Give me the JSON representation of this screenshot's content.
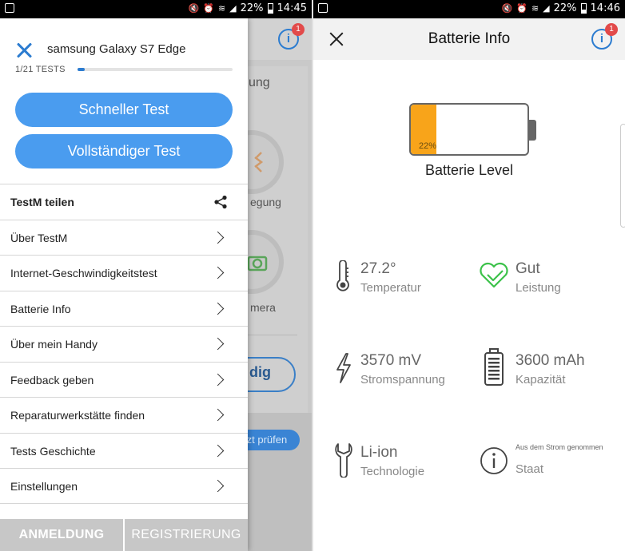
{
  "left_screen": {
    "statusbar": {
      "battery_pct": "22%",
      "time": "14:45"
    },
    "background_app": {
      "info_badge": "1",
      "partial_texts": [
        "ung",
        "egung",
        "mera"
      ],
      "pill_text": "dig",
      "small_pill_text": "tzt prüfen"
    },
    "drawer": {
      "device_title": "samsung Galaxy S7 Edge",
      "progress_text": "1/21 TESTS",
      "progress_fraction": 0.048,
      "buttons": {
        "quick": "Schneller Test",
        "full": "Vollständiger Test"
      },
      "menu": [
        {
          "label": "TestM teilen",
          "icon": "share-icon"
        },
        {
          "label": "Über TestM"
        },
        {
          "label": "Internet-Geschwindigkeitstest"
        },
        {
          "label": "Batterie Info"
        },
        {
          "label": "Über mein Handy"
        },
        {
          "label": "Feedback geben"
        },
        {
          "label": "Reparaturwerkstätte finden"
        },
        {
          "label": "Tests Geschichte"
        },
        {
          "label": "Einstellungen"
        }
      ],
      "footer": {
        "login": "ANMELDUNG",
        "register": "REGISTRIERUNG"
      }
    }
  },
  "right_screen": {
    "statusbar": {
      "battery_pct": "22%",
      "time": "14:46"
    },
    "header": {
      "title": "Batterie Info",
      "info_badge": "1"
    },
    "battery": {
      "level_fraction": 0.22,
      "level_text": "22%",
      "label": "Batterie Level",
      "fill_color": "#f8a41a"
    },
    "stats": {
      "temperature": {
        "value": "27.2°",
        "label": "Temperatur",
        "icon": "thermometer-icon"
      },
      "performance": {
        "value": "Gut",
        "label": "Leistung",
        "icon": "heart-check-icon",
        "color": "#3cc24a"
      },
      "voltage": {
        "value": "3570 mV",
        "label": "Stromspannung",
        "icon": "lightning-icon"
      },
      "capacity": {
        "value": "3600 mAh",
        "label": "Kapazität",
        "icon": "battery-icon"
      },
      "technology": {
        "value": "Li-ion",
        "label": "Technologie",
        "icon": "wrench-icon"
      },
      "state": {
        "value": "Aus dem Strom genommen",
        "label": "Staat",
        "icon": "info-circle-icon"
      }
    }
  },
  "colors": {
    "accent": "#2c7cd0",
    "button": "#4a9cef",
    "badge": "#e24a4a"
  }
}
